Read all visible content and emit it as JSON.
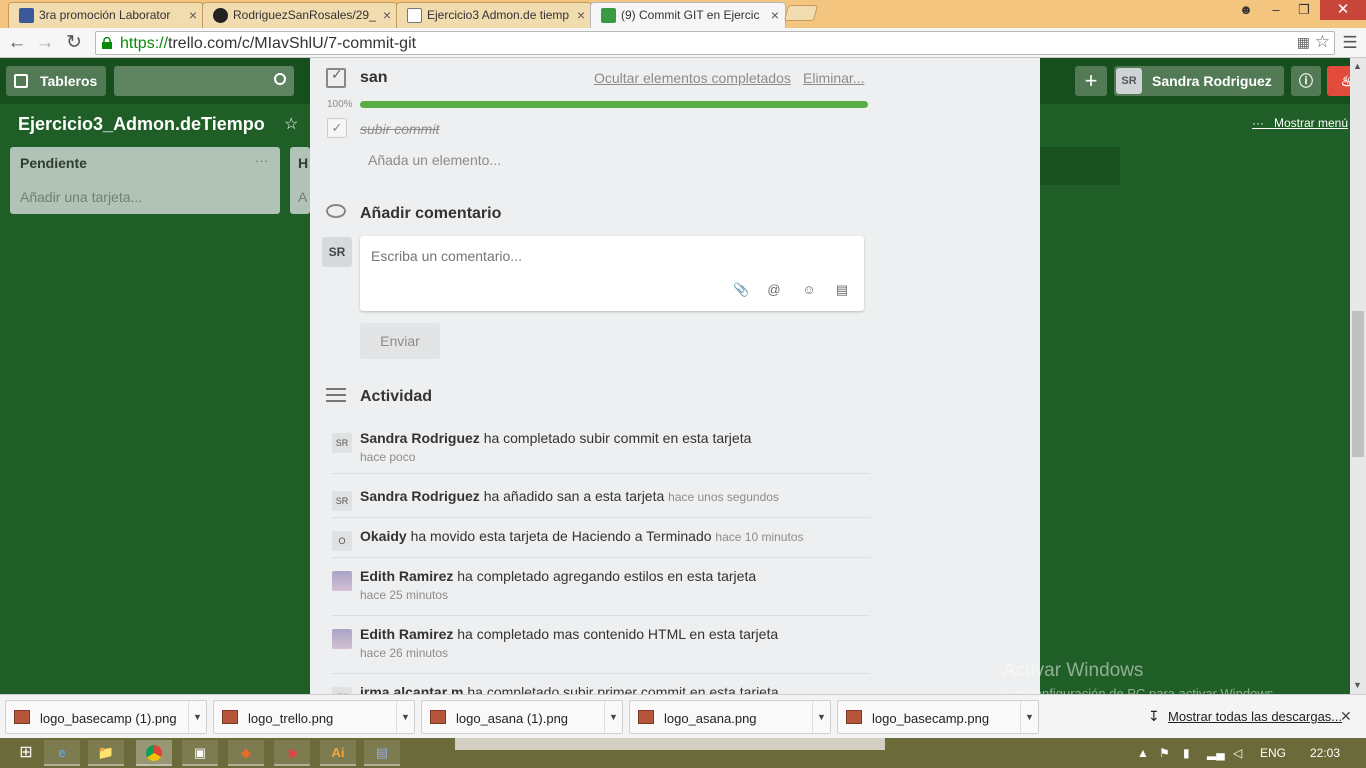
{
  "browser": {
    "tabs": [
      {
        "title": "3ra promoción Laborator",
        "favicon": "facebook-icon",
        "color": "#3b5998"
      },
      {
        "title": "RodriguezSanRosales/29_",
        "favicon": "github-icon",
        "color": "#222222"
      },
      {
        "title": "Ejercicio3 Admon.de tiemp",
        "favicon": "document-icon",
        "color": "#ffffff"
      },
      {
        "title": "(9) Commit GIT en Ejercic",
        "favicon": "trello-icon",
        "color": "#3a9a44"
      }
    ],
    "url_scheme": "https://",
    "url_rest": "trello.com/c/MIavShlU/7-commit-git"
  },
  "header": {
    "boards_label": "Tableros",
    "user_initials": "SR",
    "user_name": "Sandra Rodriguez"
  },
  "board": {
    "title": "Ejercicio3_Admon.deTiempo",
    "menu_label": "Mostrar menú",
    "lists": [
      {
        "name": "Pendiente",
        "add_label": "Añadir una tarjeta..."
      },
      {
        "name": "H",
        "add_label": "A"
      }
    ]
  },
  "checklist": {
    "title": "san",
    "hide_completed": "Ocultar elementos completados",
    "delete": "Eliminar...",
    "percent": "100%",
    "progress": 1.0,
    "items": [
      {
        "text": "subir commit",
        "done": true
      }
    ],
    "add_item_placeholder": "Añada un elemento..."
  },
  "comment": {
    "title": "Añadir comentario",
    "avatar": "SR",
    "placeholder": "Escriba un comentario...",
    "send_label": "Enviar"
  },
  "activity": {
    "title": "Actividad",
    "entries": [
      {
        "avatar": "SR",
        "user": "Sandra Rodriguez",
        "action": "ha completado subir commit en esta tarjeta",
        "time": "hace poco"
      },
      {
        "avatar": "SR",
        "user": "Sandra Rodriguez",
        "action": "ha añadido san a esta tarjeta",
        "time": "hace unos segundos"
      },
      {
        "avatar": "O",
        "user": "Okaidy",
        "action": "ha movido esta tarjeta de Haciendo a Terminado",
        "time": "hace 10 minutos"
      },
      {
        "avatar": "",
        "user": "Edith Ramirez",
        "action": "ha completado agregando estilos en esta tarjeta",
        "time": "hace 25 minutos"
      },
      {
        "avatar": "",
        "user": "Edith Ramirez",
        "action": "ha completado mas contenido HTML en esta tarjeta",
        "time": "hace 26 minutos"
      },
      {
        "avatar": "IM",
        "user": "irma alcantar m",
        "action": "ha completado subir primer commit en esta tarjeta",
        "time": ""
      }
    ]
  },
  "watermark": {
    "line1": "Activar Windows",
    "line2": "Ir a Configuración de PC para activar Windows."
  },
  "downloads": {
    "files": [
      "logo_basecamp (1).png",
      "logo_trello.png",
      "logo_asana (1).png",
      "logo_asana.png",
      "logo_basecamp.png"
    ],
    "show_all": "Mostrar todas las descargas..."
  },
  "taskbar": {
    "language": "ENG",
    "clock": "22:03"
  }
}
